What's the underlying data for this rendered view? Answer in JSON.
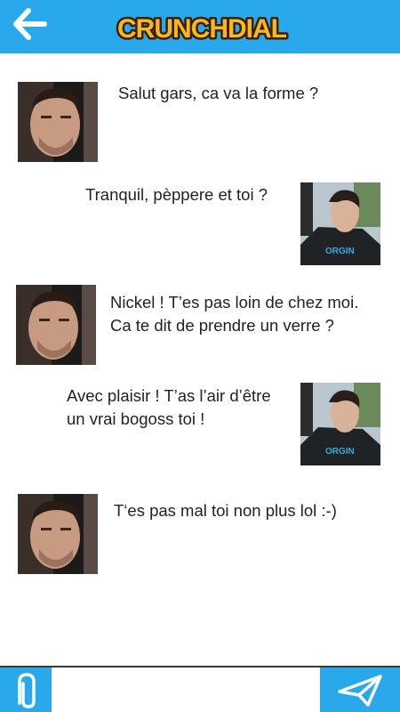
{
  "app": {
    "name": "CRUNCHDIAL",
    "accent_color": "#29a9ec"
  },
  "header": {
    "back_icon": "arrow-left-icon",
    "logo_text": "CRUNCHDIAL"
  },
  "messages": [
    {
      "sender": "contact",
      "text": "Salut gars, ca va la forme ?"
    },
    {
      "sender": "me",
      "text": "Tranquil, pèppere et toi ?"
    },
    {
      "sender": "contact",
      "text": "Nickel ! T’es pas loin de chez moi.\nCa te dit de prendre un verre ?"
    },
    {
      "sender": "me",
      "text": "Avec plaisir ! T’as l’air d’être\nun vrai bogoss toi !"
    },
    {
      "sender": "contact",
      "text": "T‘es pas mal toi non plus lol :-)"
    }
  ],
  "composer": {
    "placeholder": "",
    "attach_icon": "paperclip-icon",
    "send_icon": "paper-plane-icon"
  }
}
